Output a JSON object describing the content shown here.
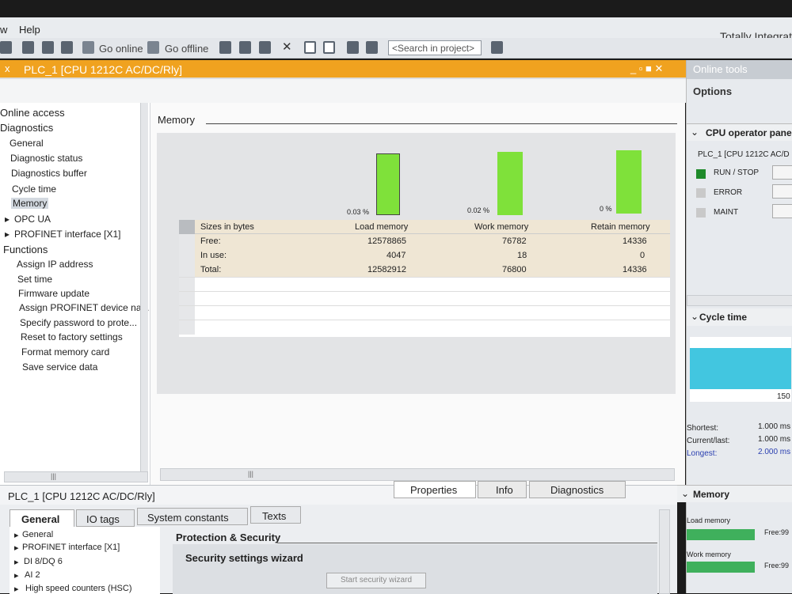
{
  "menu": {
    "item1": "w",
    "help": "Help"
  },
  "toolbar": {
    "go_online": "Go online",
    "go_offline": "Go offline",
    "search_placeholder": "<Search in project>"
  },
  "brand": "Totally Integrat",
  "editor": {
    "title": "PLC_1 [CPU 1212C AC/DC/Rly]",
    "close": "x",
    "win_controls": "_ ▫ ■ ✕"
  },
  "nav": {
    "online_access": "Online access",
    "diagnostics": "Diagnostics",
    "general": "General",
    "diag_status": "Diagnostic status",
    "diag_buffer": "Diagnostics buffer",
    "cycle_time": "Cycle time",
    "memory": "Memory",
    "opc_ua": "OPC UA",
    "profinet": "PROFINET interface [X1]",
    "functions": "Functions",
    "assign_ip": "Assign IP address",
    "set_time": "Set time",
    "firmware": "Firmware update",
    "assign_pn": "Assign PROFINET device na...",
    "specify_pw": "Specify password to prote...",
    "reset": "Reset to factory settings",
    "format_mc": "Format memory card",
    "save_service": "Save service data"
  },
  "main": {
    "heading": "Memory",
    "bars": [
      {
        "pct_label": "0.03 %",
        "fill": 0.0003
      },
      {
        "pct_label": "0.02 %",
        "fill": 0.0002
      },
      {
        "pct_label": "0 %",
        "fill": 0.0
      }
    ],
    "table": {
      "headers": [
        "Sizes in bytes",
        "Load memory",
        "Work memory",
        "Retain memory"
      ],
      "rows": [
        [
          "Free:",
          "12578865",
          "76782",
          "14336"
        ],
        [
          "In use:",
          "4047",
          "18",
          "0"
        ],
        [
          "Total:",
          "12582912",
          "76800",
          "14336"
        ]
      ]
    },
    "scroll_thumb": "|||"
  },
  "right": {
    "title": "Online tools",
    "options": "Options",
    "cpu_panel": "CPU operator pane",
    "cpu_name": "PLC_1 [CPU 1212C AC/D",
    "run_stop": "RUN / STOP",
    "error": "ERROR",
    "maint": "MAINT",
    "cycle_time": "Cycle time",
    "cycle_axis": "150",
    "shortest_label": "Shortest:",
    "shortest_val": "1.000 ms",
    "current_label": "Current/last:",
    "current_val": "1.000 ms",
    "longest_label": "Longest:",
    "longest_val": "2.000 ms",
    "memory": "Memory",
    "load_memory": "Load memory",
    "work_memory": "Work memory",
    "free_label1": "Free:99",
    "free_label2": "Free:99",
    "colors": {
      "run": "#1f8a2a",
      "cycle_chart": "#42c6e0"
    }
  },
  "bottom": {
    "title": "PLC_1 [CPU 1212C AC/DC/Rly]",
    "tabs_top": {
      "properties": "Properties",
      "info": "Info",
      "diagnostics": "Diagnostics"
    },
    "tabs": {
      "general": "General",
      "io_tags": "IO tags",
      "system_constants": "System constants",
      "texts": "Texts"
    },
    "tree": {
      "general": "General",
      "profinet": "PROFINET interface [X1]",
      "di8": "DI 8/DQ 6",
      "ai2": "AI 2",
      "hsc": "High speed counters (HSC)"
    },
    "protection": "Protection & Security",
    "wizard_title": "Security settings wizard",
    "wizard_button": "Start security wizard"
  }
}
